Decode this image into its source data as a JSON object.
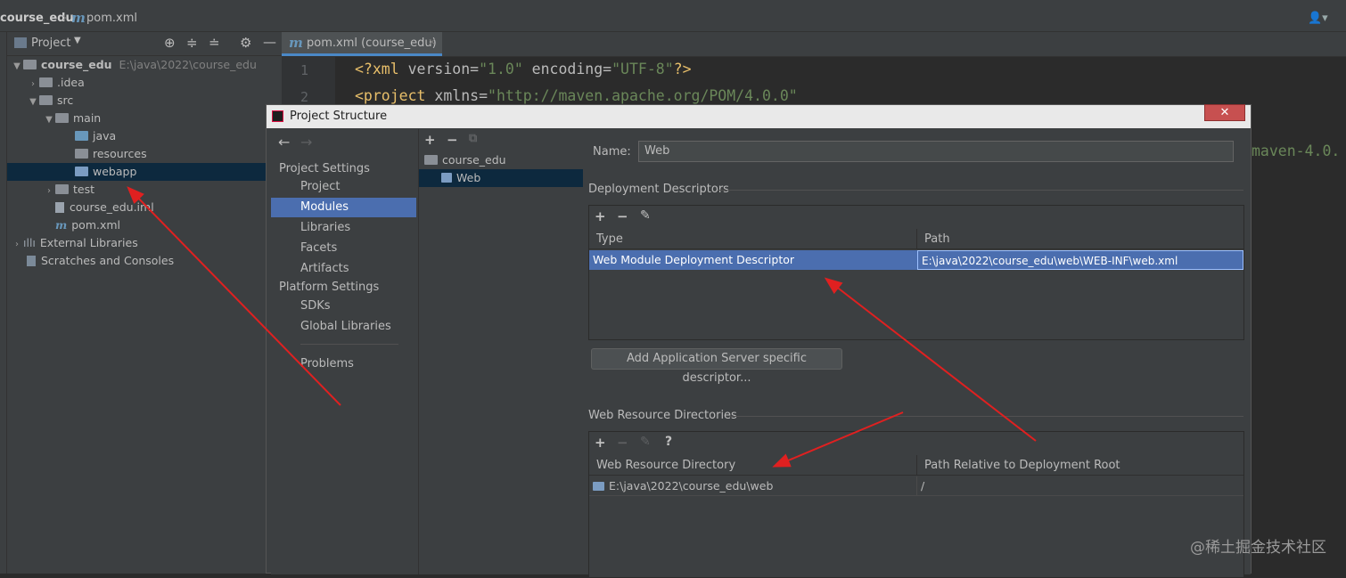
{
  "navbar": {
    "project": "course_edu",
    "file": "pom.xml"
  },
  "project_panel": {
    "title": "Project",
    "tree": [
      {
        "label": "course_edu",
        "extra": "E:\\java\\2022\\course_edu"
      },
      {
        "label": ".idea"
      },
      {
        "label": "src"
      },
      {
        "label": "main"
      },
      {
        "label": "java"
      },
      {
        "label": "resources"
      },
      {
        "label": "webapp"
      },
      {
        "label": "test"
      },
      {
        "label": "course_edu.iml"
      },
      {
        "label": "pom.xml"
      },
      {
        "label": "External Libraries"
      },
      {
        "label": "Scratches and Consoles"
      }
    ]
  },
  "editor": {
    "tab": "pom.xml (course_edu)",
    "lines": [
      "1",
      "2"
    ],
    "line1": {
      "open": "<?xml",
      "a1": " version=",
      "v1": "\"1.0\"",
      "a2": " encoding=",
      "v2": "\"UTF-8\"",
      "close": "?>"
    },
    "line2": {
      "tag": "<project",
      "attr": " xmlns=",
      "val": "\"http://maven.apache.org/POM/4.0.0\""
    },
    "right_fragment": "maven-4.0."
  },
  "dialog": {
    "title": "Project Structure",
    "close": "✕",
    "sidebar": {
      "project_settings": "Project Settings",
      "items1": [
        "Project",
        "Modules",
        "Libraries",
        "Facets",
        "Artifacts"
      ],
      "platform_settings": "Platform Settings",
      "items2": [
        "SDKs",
        "Global Libraries"
      ],
      "problems": "Problems"
    },
    "tree": {
      "root": "course_edu",
      "child": "Web"
    },
    "name_label": "Name:",
    "name_value": "Web",
    "deployment": {
      "title": "Deployment Descriptors",
      "columns": [
        "Type",
        "Path"
      ],
      "row": {
        "type": "Web Module Deployment Descriptor",
        "path": "E:\\java\\2022\\course_edu\\web\\WEB-INF\\web.xml"
      },
      "add_button": "Add Application Server specific descriptor..."
    },
    "resources": {
      "title": "Web Resource Directories",
      "columns": [
        "Web Resource Directory",
        "Path Relative to Deployment Root"
      ],
      "row": {
        "dir": "E:\\java\\2022\\course_edu\\web",
        "path": "/"
      },
      "help": "?"
    }
  },
  "watermark": "@稀土掘金技术社区"
}
